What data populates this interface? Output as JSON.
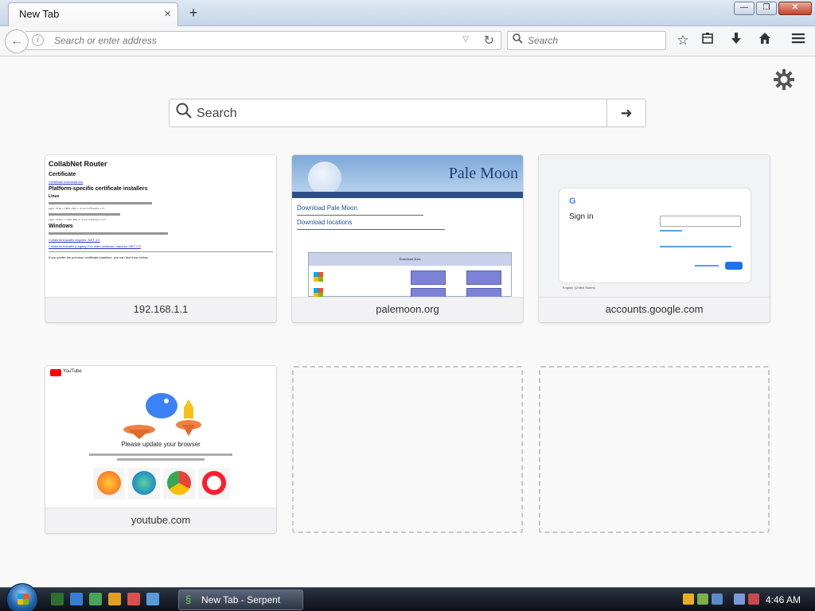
{
  "browser": {
    "tab": {
      "title": "New Tab",
      "close": "×"
    },
    "new_tab": "+",
    "window_controls": {
      "minimize": "—",
      "maximize": "❐",
      "close": "✕"
    },
    "urlbar": {
      "placeholder": "Search or enter address",
      "info": "i"
    },
    "searchbar": {
      "placeholder": "Search"
    },
    "toolbar_icons": [
      "star-icon",
      "library-icon",
      "download-icon",
      "home-icon",
      "menu-icon"
    ]
  },
  "newtab": {
    "search": {
      "placeholder": "Search",
      "go": "➜"
    },
    "tiles": [
      {
        "label": "192.168.1.1"
      },
      {
        "label": "palemoon.org"
      },
      {
        "label": "accounts.google.com"
      },
      {
        "label": "youtube.com"
      }
    ],
    "thumb_router": {
      "title": "CollabNet Router",
      "cert": "Certificate",
      "cert_link": "Certificate download link",
      "heading": "Platform-specific certificate installers",
      "linux": "Linux",
      "windows": "Windows",
      "win_link1": "Collabnet Installer requires .NET 4.0",
      "win_link2": "Collabnet Installer (Legacy) For older windows, requires .NET 3.5",
      "footer": "If you prefer the previous certificate installers, you can find them below"
    },
    "thumb_palemoon": {
      "brand": "Pale Moon",
      "heading1": "Download Pale Moon",
      "heading2": "Download locations",
      "table_header": "Download links",
      "col_os": "Operating System",
      "col_sig": "Signature",
      "col_am": "Americas",
      "col_eu": "Europe"
    },
    "thumb_google": {
      "logo": "G",
      "title": "Sign in",
      "lang": "English (United States)"
    },
    "thumb_youtube": {
      "brand": "YouTube",
      "message": "Please update your browser",
      "browsers": [
        "Mozilla Firefox",
        "Microsoft Edge",
        "Google Chrome",
        "Opera"
      ]
    }
  },
  "taskbar": {
    "task_label": "New Tab - Serpent",
    "clock": "4:46 AM"
  },
  "colors": {
    "accent": "#1a73e8",
    "taskbar": "#1a1f29",
    "page_bg": "#f9f9fa"
  }
}
